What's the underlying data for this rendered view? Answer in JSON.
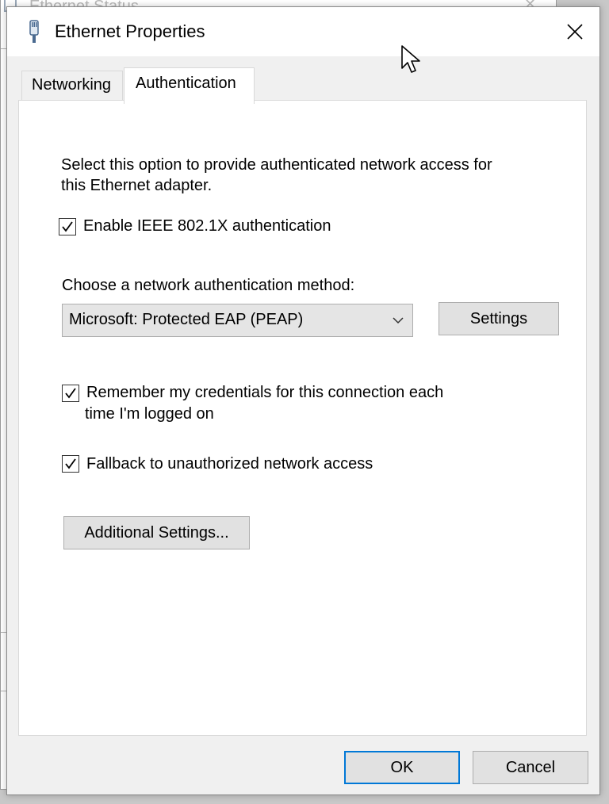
{
  "background_window": {
    "title": "Ethernet Status"
  },
  "dialog": {
    "title": "Ethernet Properties",
    "icon": "ethernet-adapter-icon",
    "close_icon": "close-icon"
  },
  "tabs": [
    {
      "label": "Networking",
      "selected": false
    },
    {
      "label": "Authentication",
      "selected": true
    }
  ],
  "authentication": {
    "description_line1": "Select this option to provide authenticated network access for",
    "description_line2": "this Ethernet adapter.",
    "enable_8021x": {
      "label": "Enable IEEE 802.1X authentication",
      "checked": true
    },
    "method_label": "Choose a network authentication method:",
    "method_selected": "Microsoft: Protected EAP (PEAP)",
    "settings_button": "Settings",
    "remember_credentials": {
      "label_line1": "Remember my credentials for this connection each",
      "label_line2": "time I'm logged on",
      "checked": true
    },
    "fallback": {
      "label": "Fallback to unauthorized network access",
      "checked": true
    },
    "additional_settings_button": "Additional Settings..."
  },
  "footer": {
    "ok_button": "OK",
    "cancel_button": "Cancel"
  },
  "colors": {
    "accent": "#0078d7",
    "dialog_bg": "#f0f0f0",
    "panel_bg": "#ffffff"
  }
}
